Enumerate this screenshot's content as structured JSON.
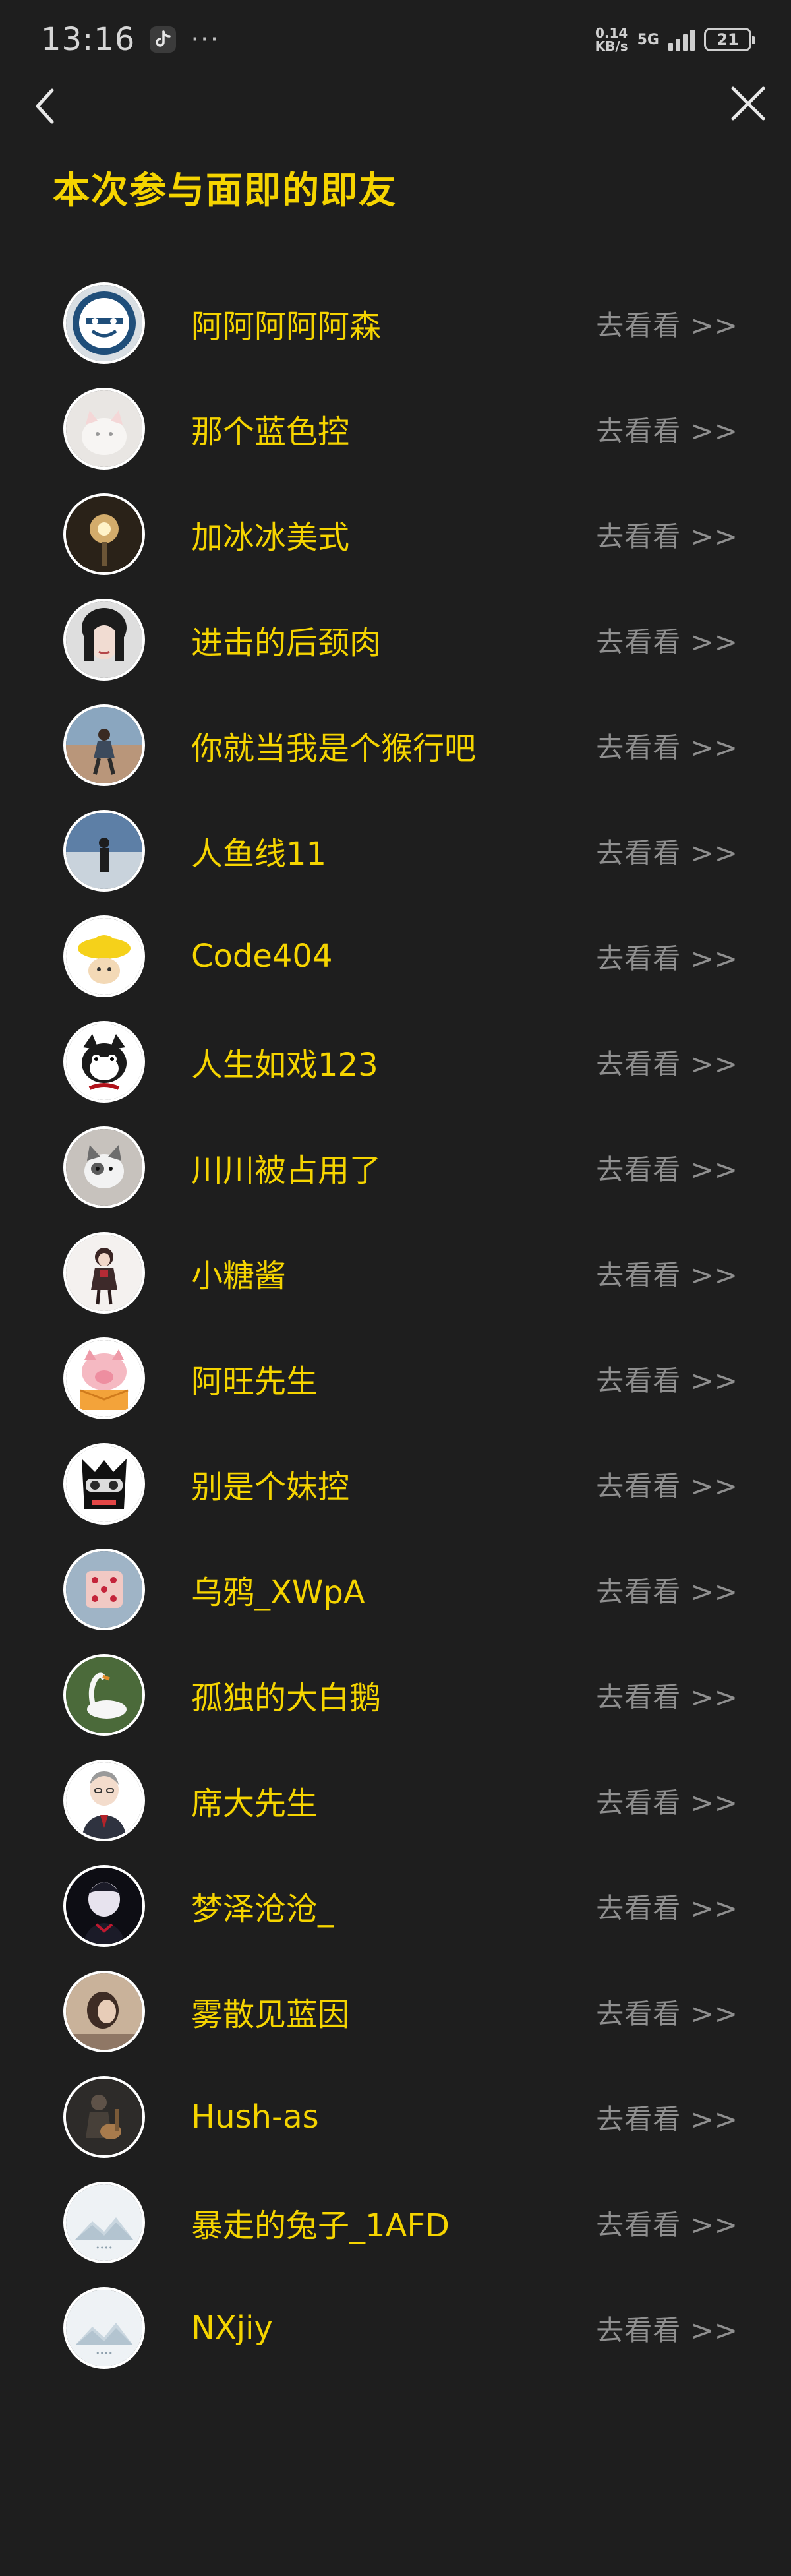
{
  "status_bar": {
    "time": "13:16",
    "dots": "···",
    "speed_value": "0.14",
    "speed_unit": "KB/s",
    "network": "5G",
    "battery": "21"
  },
  "header": {
    "title": "本次参与面即的即友"
  },
  "friends": [
    {
      "name": "阿阿阿阿阿森",
      "link": "去看看 >>",
      "avatar_icon": "face-mask-icon"
    },
    {
      "name": "那个蓝色控",
      "link": "去看看 >>",
      "avatar_icon": "white-cat-icon"
    },
    {
      "name": "加冰冰美式",
      "link": "去看看 >>",
      "avatar_icon": "lamp-icon"
    },
    {
      "name": "进击的后颈肉",
      "link": "去看看 >>",
      "avatar_icon": "portrait-icon"
    },
    {
      "name": "你就当我是个猴行吧",
      "link": "去看看 >>",
      "avatar_icon": "beach-person-icon"
    },
    {
      "name": "人鱼线11",
      "link": "去看看 >>",
      "avatar_icon": "sea-person-icon"
    },
    {
      "name": "Code404",
      "link": "去看看 >>",
      "avatar_icon": "yellow-hat-icon"
    },
    {
      "name": "人生如戏123",
      "link": "去看看 >>",
      "avatar_icon": "cartoon-cat-icon"
    },
    {
      "name": "川川被占用了",
      "link": "去看看 >>",
      "avatar_icon": "kitten-icon"
    },
    {
      "name": "小糖酱",
      "link": "去看看 >>",
      "avatar_icon": "girl-figure-icon"
    },
    {
      "name": "阿旺先生",
      "link": "去看看 >>",
      "avatar_icon": "pig-icon"
    },
    {
      "name": "别是个妹控",
      "link": "去看看 >>",
      "avatar_icon": "goggles-cartoon-icon"
    },
    {
      "name": "乌鸦_XWpA",
      "link": "去看看 >>",
      "avatar_icon": "dice-photo-icon"
    },
    {
      "name": "孤独的大白鹅",
      "link": "去看看 >>",
      "avatar_icon": "swan-icon"
    },
    {
      "name": "席大先生",
      "link": "去看看 >>",
      "avatar_icon": "suit-man-icon"
    },
    {
      "name": "梦泽沧沧_",
      "link": "去看看 >>",
      "avatar_icon": "dark-boy-icon"
    },
    {
      "name": "雾散见蓝因",
      "link": "去看看 >>",
      "avatar_icon": "sepia-girl-icon"
    },
    {
      "name": "Hush-as",
      "link": "去看看 >>",
      "avatar_icon": "guitar-photo-icon"
    },
    {
      "name": "暴走的兔子_1AFD",
      "link": "去看看 >>",
      "avatar_icon": "default-avatar-icon"
    },
    {
      "name": "NXjiy",
      "link": "去看看 >>",
      "avatar_icon": "default-avatar-icon"
    }
  ],
  "colors": {
    "background": "#1e1e1e",
    "accent_yellow": "#f5d400",
    "link_gray": "#8f8f8f"
  }
}
